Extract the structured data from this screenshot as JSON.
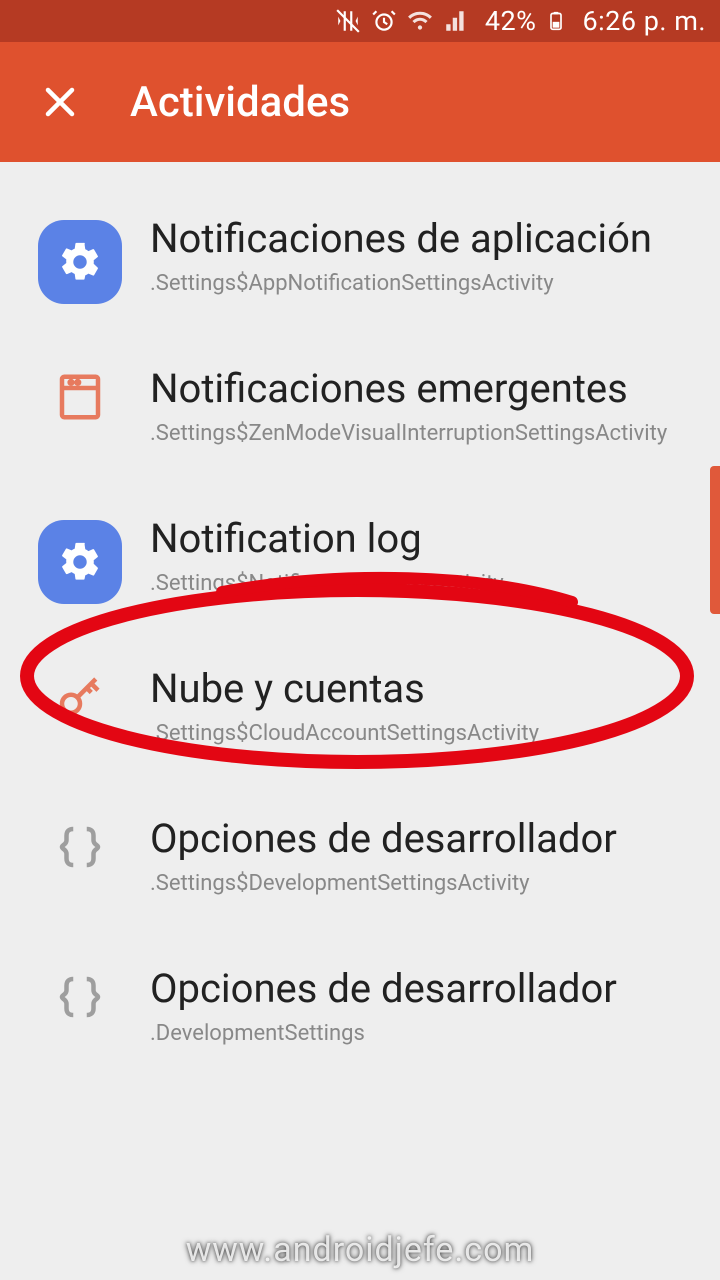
{
  "status_bar": {
    "battery_text": "42%",
    "clock": "6:26 p. m."
  },
  "app_bar": {
    "title": "Actividades"
  },
  "list": [
    {
      "title": "Notificaciones de aplicación",
      "subtitle": ".Settings$AppNotificationSettingsActivity",
      "icon": "gear-blue"
    },
    {
      "title": "Notificaciones emergentes",
      "subtitle": ".Settings$ZenModeVisualInterruptionSettingsActivity",
      "icon": "archive-orange"
    },
    {
      "title": "Notification log",
      "subtitle": ".Settings$NotificationStationActivity",
      "icon": "gear-blue"
    },
    {
      "title": "Nube y cuentas",
      "subtitle": ".Settings$CloudAccountSettingsActivity",
      "icon": "key-orange"
    },
    {
      "title": "Opciones de desarrollador",
      "subtitle": ".Settings$DevelopmentSettingsActivity",
      "icon": "braces-gray"
    },
    {
      "title": "Opciones de desarrollador",
      "subtitle": ".DevelopmentSettings",
      "icon": "braces-gray"
    }
  ],
  "watermark": "www.androidjefe.com"
}
